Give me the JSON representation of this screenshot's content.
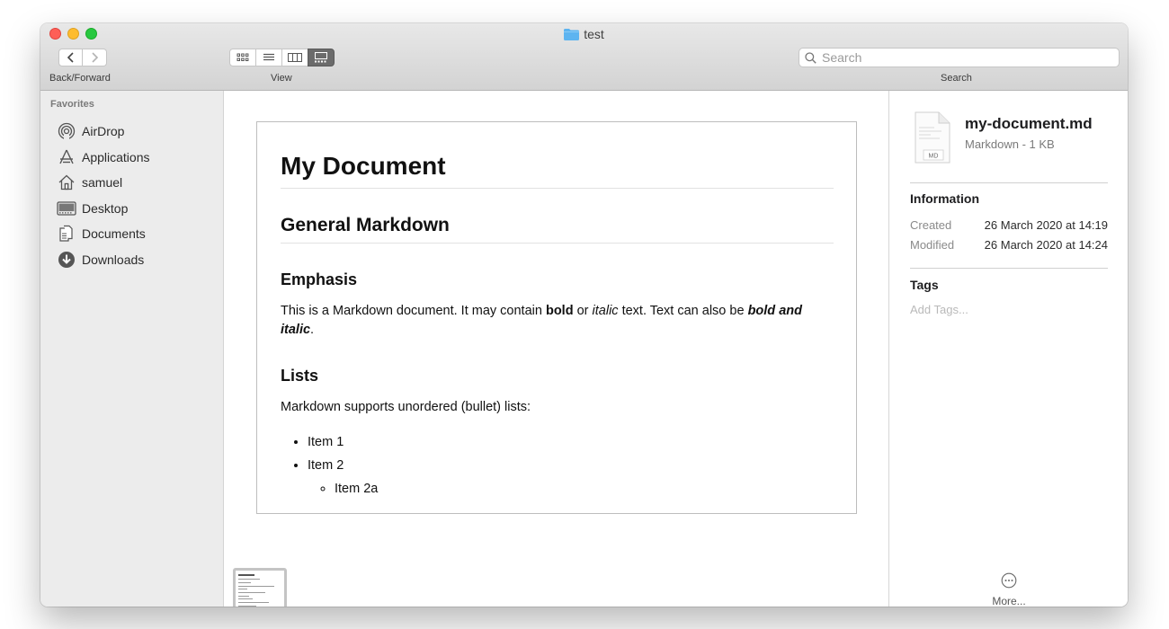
{
  "window": {
    "title": "test"
  },
  "toolbar": {
    "back_forward_label": "Back/Forward",
    "view_label": "View",
    "search_label": "Search",
    "search_placeholder": "Search"
  },
  "sidebar": {
    "heading": "Favorites",
    "items": [
      {
        "label": "AirDrop",
        "icon": "airdrop-icon"
      },
      {
        "label": "Applications",
        "icon": "applications-icon"
      },
      {
        "label": "samuel",
        "icon": "home-icon"
      },
      {
        "label": "Desktop",
        "icon": "desktop-icon"
      },
      {
        "label": "Documents",
        "icon": "documents-icon"
      },
      {
        "label": "Downloads",
        "icon": "downloads-icon"
      }
    ]
  },
  "document": {
    "h1": "My Document",
    "h2": "General Markdown",
    "h3_emphasis": "Emphasis",
    "p1": {
      "part1": "This is a Markdown document. It may contain ",
      "bold": "bold",
      "part2": " or ",
      "italic": "italic",
      "part3": " text. Text can also be ",
      "bold_italic": "bold and italic",
      "part4": "."
    },
    "h3_lists": "Lists",
    "p2": "Markdown supports unordered (bullet) lists:",
    "list": [
      "Item 1",
      "Item 2"
    ],
    "sublist": [
      "Item 2a"
    ]
  },
  "inspector": {
    "file_name": "my-document.md",
    "file_meta": "Markdown - 1 KB",
    "file_badge": "MD",
    "info_heading": "Information",
    "created_label": "Created",
    "created_value": "26 March 2020 at 14:19",
    "modified_label": "Modified",
    "modified_value": "26 March 2020 at 14:24",
    "tags_heading": "Tags",
    "tags_placeholder": "Add Tags...",
    "more_label": "More..."
  },
  "colors": {
    "close": "#fe5f57",
    "minimize": "#febc2e",
    "maximize": "#28c840",
    "folder": "#5db4f0"
  }
}
